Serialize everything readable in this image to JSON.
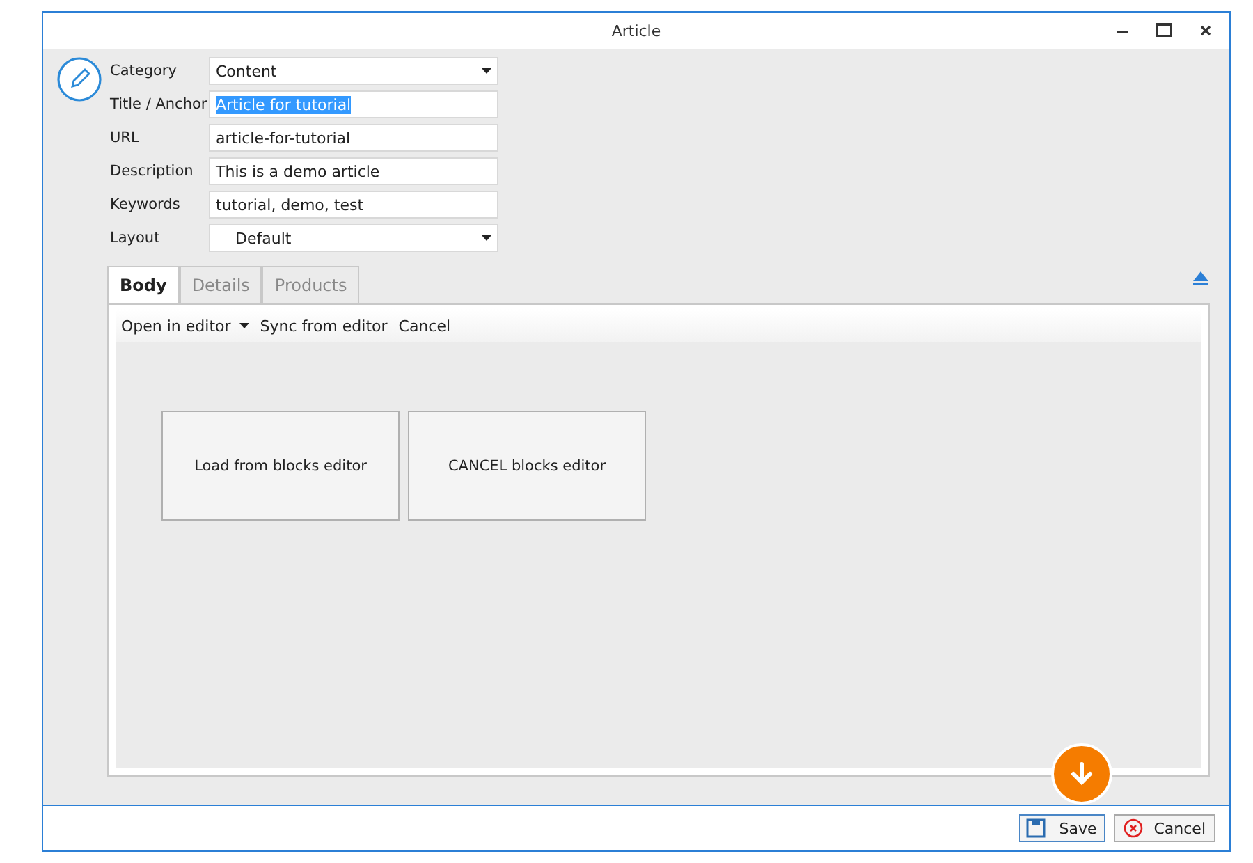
{
  "window": {
    "title": "Article"
  },
  "fields": [
    {
      "label": "Category",
      "kind": "dropdown",
      "value": "Content"
    },
    {
      "label": "Title / Anchor",
      "kind": "text",
      "value": "Article for tutorial",
      "highlighted": true
    },
    {
      "label": "URL",
      "kind": "text",
      "value": "article-for-tutorial"
    },
    {
      "label": "Description",
      "kind": "text",
      "value": "This is a demo article"
    },
    {
      "label": "Keywords",
      "kind": "text",
      "value": "tutorial, demo, test"
    },
    {
      "label": "Layout",
      "kind": "dropdown",
      "value": "Default"
    }
  ],
  "tabs": [
    {
      "label": "Body",
      "selected": true
    },
    {
      "label": "Details",
      "selected": false
    },
    {
      "label": "Products",
      "selected": false
    }
  ],
  "toolbar": [
    {
      "label": "Open in editor",
      "kind": "dropdown"
    },
    {
      "label": "Sync from editor",
      "kind": "button"
    },
    {
      "label": "Cancel",
      "kind": "button"
    }
  ],
  "editor_buttons": [
    "Load from blocks editor",
    "CANCEL blocks editor"
  ],
  "footer_buttons": [
    {
      "label": "Save",
      "kind": "save"
    },
    {
      "label": "Cancel",
      "kind": "cancel"
    }
  ]
}
